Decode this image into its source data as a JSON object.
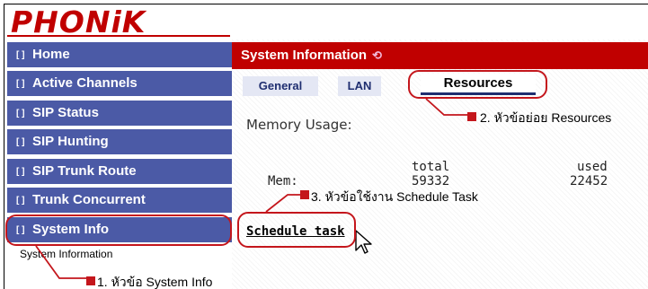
{
  "brand": {
    "logo_text": "PHONiK"
  },
  "sidebar": {
    "items": [
      {
        "icon": "bracket-icon",
        "label": "Home"
      },
      {
        "icon": "bracket-icon",
        "label": "Active Channels"
      },
      {
        "icon": "bracket-icon",
        "label": "SIP Status"
      },
      {
        "icon": "bracket-icon",
        "label": "SIP Hunting"
      },
      {
        "icon": "bracket-icon",
        "label": "SIP Trunk Route"
      },
      {
        "icon": "bracket-icon",
        "label": "Trunk Concurrent"
      },
      {
        "icon": "bracket-icon",
        "label": "System Info"
      }
    ],
    "sub_item": "System Information"
  },
  "content": {
    "header_title": "System Information",
    "header_icon": "refresh-icon",
    "tabs": [
      {
        "label": "General"
      },
      {
        "label": "LAN"
      },
      {
        "label": "Resources",
        "active": true
      }
    ],
    "memory_label": "Memory Usage:",
    "mem_table": {
      "columns": [
        "total",
        "used"
      ],
      "row_label": "Mem:",
      "total": "59332",
      "used": "22452"
    },
    "schedule_link": "Schedule task"
  },
  "annotations": {
    "a1": "1. หัวข้อ System Info",
    "a2": "2. หัวข้อย่อย Resources",
    "a3": "3. หัวข้อใช้งาน Schedule Task"
  },
  "colors": {
    "nav_blue": "#4b5aa6",
    "brand_red": "#c00000",
    "callout_red": "#c4161c"
  }
}
